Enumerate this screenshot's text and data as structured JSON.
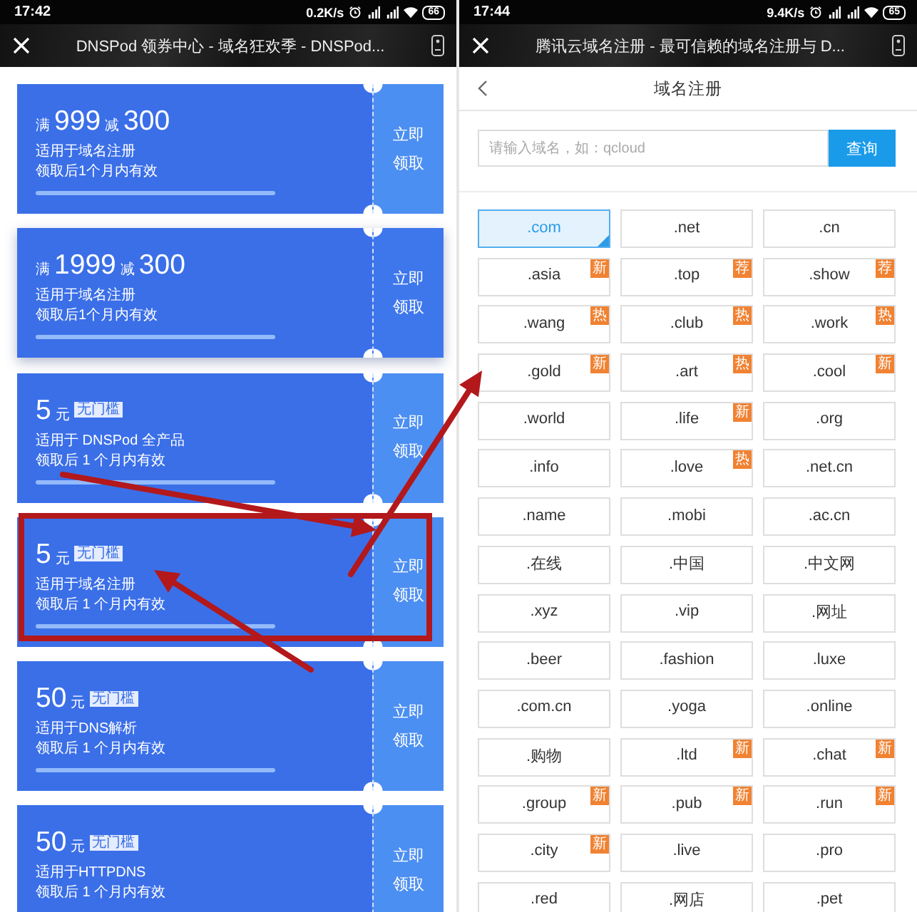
{
  "left_screen": {
    "status_bar": {
      "time": "17:42",
      "speed": "0.2K/s",
      "battery": "66"
    },
    "title_bar": {
      "title": "DNSPod 领券中心 - 域名狂欢季 - DNSPod..."
    },
    "coupons": [
      {
        "kind": "threshold",
        "condition": "满",
        "threshold": "999",
        "reduce": "减",
        "amount": "300",
        "scope": "适用于域名注册",
        "validity": "领取后1个月内有效",
        "action": "立即领取",
        "highlighted": false
      },
      {
        "kind": "threshold",
        "condition": "满",
        "threshold": "1999",
        "reduce": "减",
        "amount": "300",
        "scope": "适用于域名注册",
        "validity": "领取后1个月内有效",
        "action": "立即领取",
        "highlighted": true
      },
      {
        "kind": "no_threshold",
        "amount": "5",
        "unit": "元",
        "tag": "无门槛",
        "scope": "适用于 DNSPod 全产品",
        "validity": "领取后 1 个月内有效",
        "action": "立即领取",
        "highlighted": false
      },
      {
        "kind": "no_threshold",
        "amount": "5",
        "unit": "元",
        "tag": "无门槛",
        "scope": "适用于域名注册",
        "validity": "领取后 1 个月内有效",
        "action": "立即领取",
        "highlighted": false
      },
      {
        "kind": "no_threshold",
        "amount": "50",
        "unit": "元",
        "tag": "无门槛",
        "scope": "适用于DNS解析",
        "validity": "领取后 1 个月内有效",
        "action": "立即领取",
        "highlighted": false
      },
      {
        "kind": "no_threshold",
        "amount": "50",
        "unit": "元",
        "tag": "无门槛",
        "scope": "适用于HTTPDNS",
        "validity": "领取后 1 个月内有效",
        "action": "立即领取",
        "highlighted": false
      }
    ]
  },
  "right_screen": {
    "status_bar": {
      "time": "17:44",
      "speed": "9.4K/s",
      "battery": "65"
    },
    "title_bar": {
      "title": "腾讯云域名注册 - 最可信赖的域名注册与 D..."
    },
    "header": {
      "title": "域名注册"
    },
    "search": {
      "placeholder": "请输入域名，如：qcloud",
      "button": "查询"
    },
    "domains": [
      {
        "name": ".com",
        "selected": true
      },
      {
        "name": ".net",
        "selected": false
      },
      {
        "name": ".cn",
        "selected": false
      },
      {
        "name": ".asia",
        "selected": false,
        "badge": "新"
      },
      {
        "name": ".top",
        "selected": false,
        "badge": "荐"
      },
      {
        "name": ".show",
        "selected": false,
        "badge": "荐"
      },
      {
        "name": ".wang",
        "selected": false,
        "badge": "热"
      },
      {
        "name": ".club",
        "selected": false,
        "badge": "热"
      },
      {
        "name": ".work",
        "selected": false,
        "badge": "热"
      },
      {
        "name": ".gold",
        "selected": false,
        "badge": "新"
      },
      {
        "name": ".art",
        "selected": false,
        "badge": "热"
      },
      {
        "name": ".cool",
        "selected": false,
        "badge": "新"
      },
      {
        "name": ".world",
        "selected": false
      },
      {
        "name": ".life",
        "selected": false,
        "badge": "新"
      },
      {
        "name": ".org",
        "selected": false
      },
      {
        "name": ".info",
        "selected": false
      },
      {
        "name": ".love",
        "selected": false,
        "badge": "热"
      },
      {
        "name": ".net.cn",
        "selected": false
      },
      {
        "name": ".name",
        "selected": false
      },
      {
        "name": ".mobi",
        "selected": false
      },
      {
        "name": ".ac.cn",
        "selected": false
      },
      {
        "name": ".在线",
        "selected": false
      },
      {
        "name": ".中国",
        "selected": false
      },
      {
        "name": ".中文网",
        "selected": false
      },
      {
        "name": ".xyz",
        "selected": false
      },
      {
        "name": ".vip",
        "selected": false
      },
      {
        "name": ".网址",
        "selected": false
      },
      {
        "name": ".beer",
        "selected": false
      },
      {
        "name": ".fashion",
        "selected": false
      },
      {
        "name": ".luxe",
        "selected": false
      },
      {
        "name": ".com.cn",
        "selected": false
      },
      {
        "name": ".yoga",
        "selected": false
      },
      {
        "name": ".online",
        "selected": false
      },
      {
        "name": ".购物",
        "selected": false
      },
      {
        "name": ".ltd",
        "selected": false,
        "badge": "新"
      },
      {
        "name": ".chat",
        "selected": false,
        "badge": "新"
      },
      {
        "name": ".group",
        "selected": false,
        "badge": "新"
      },
      {
        "name": ".pub",
        "selected": false,
        "badge": "新"
      },
      {
        "name": ".run",
        "selected": false,
        "badge": "新"
      },
      {
        "name": ".city",
        "selected": false,
        "badge": "新"
      },
      {
        "name": ".live",
        "selected": false
      },
      {
        "name": ".pro",
        "selected": false
      },
      {
        "name": ".red",
        "selected": false
      },
      {
        "name": ".网店",
        "selected": false
      },
      {
        "name": ".pet",
        "selected": false
      }
    ]
  }
}
